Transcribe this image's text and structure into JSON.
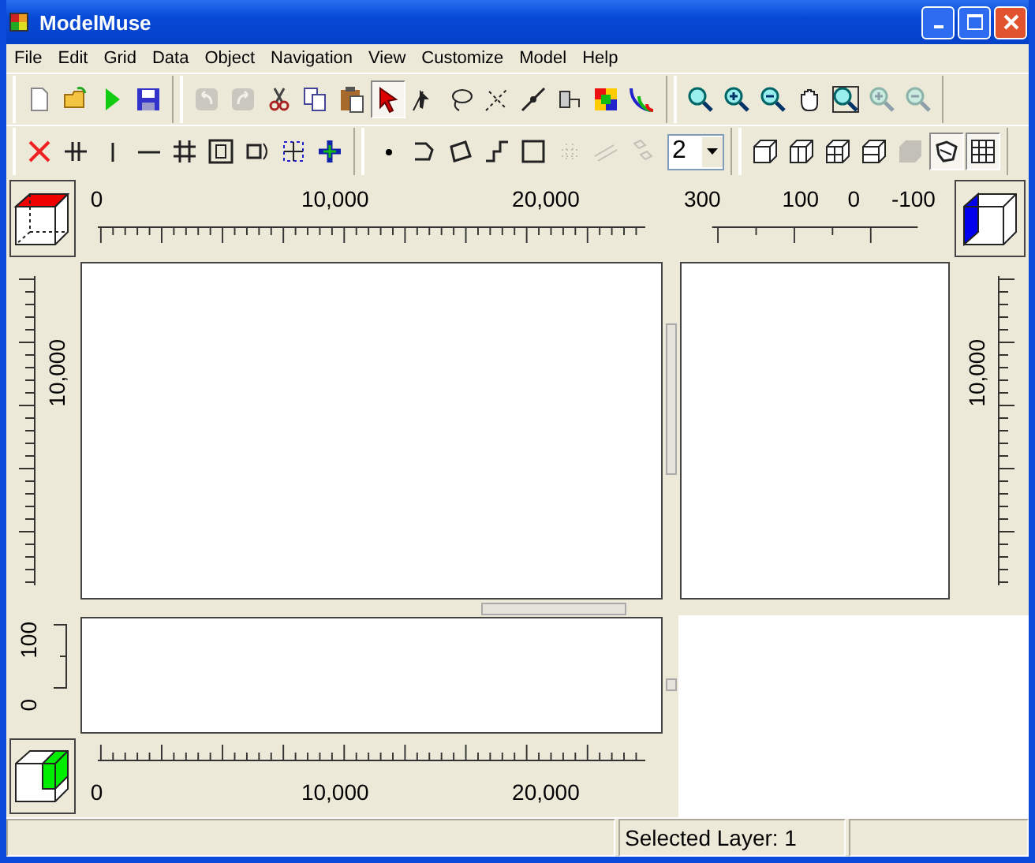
{
  "window": {
    "title": "ModelMuse"
  },
  "menu": [
    "File",
    "Edit",
    "Grid",
    "Data",
    "Object",
    "Navigation",
    "View",
    "Customize",
    "Model",
    "Help"
  ],
  "toolbars": [
    {
      "groups": [
        {
          "items": [
            {
              "kind": "new",
              "disabled": false,
              "selected": false
            },
            {
              "kind": "open",
              "disabled": false,
              "selected": false
            },
            {
              "kind": "run",
              "disabled": false,
              "selected": false
            },
            {
              "kind": "save",
              "disabled": false,
              "selected": false
            }
          ]
        },
        {
          "items": [
            {
              "kind": "undo",
              "disabled": true,
              "selected": false
            },
            {
              "kind": "redo",
              "disabled": true,
              "selected": false
            },
            {
              "kind": "cut",
              "disabled": false,
              "selected": false
            },
            {
              "kind": "copy",
              "disabled": false,
              "selected": false
            },
            {
              "kind": "paste",
              "disabled": false,
              "selected": false
            },
            {
              "kind": "pointer",
              "disabled": false,
              "selected": true
            },
            {
              "kind": "vertex",
              "disabled": false,
              "selected": false
            },
            {
              "kind": "lasso",
              "disabled": false,
              "selected": false
            },
            {
              "kind": "dashx",
              "disabled": false,
              "selected": false
            },
            {
              "kind": "nodeline",
              "disabled": false,
              "selected": false
            },
            {
              "kind": "connector",
              "disabled": false,
              "selected": false
            },
            {
              "kind": "colorgrid",
              "disabled": false,
              "selected": false
            },
            {
              "kind": "contour",
              "disabled": false,
              "selected": false
            }
          ]
        },
        {
          "items": [
            {
              "kind": "zoom",
              "disabled": false,
              "selected": false
            },
            {
              "kind": "zoomin",
              "disabled": false,
              "selected": false
            },
            {
              "kind": "zoomout",
              "disabled": false,
              "selected": false
            },
            {
              "kind": "pan",
              "disabled": false,
              "selected": false
            },
            {
              "kind": "zoomextent",
              "disabled": false,
              "selected": false
            },
            {
              "kind": "zoomin",
              "disabled": true,
              "selected": false
            },
            {
              "kind": "zoomout",
              "disabled": true,
              "selected": false
            }
          ]
        }
      ]
    },
    {
      "groups": [
        {
          "items": [
            {
              "kind": "redx",
              "disabled": false,
              "selected": false
            },
            {
              "kind": "splitcol",
              "disabled": false,
              "selected": false
            },
            {
              "kind": "vline",
              "disabled": false,
              "selected": false
            },
            {
              "kind": "hline",
              "disabled": false,
              "selected": false
            },
            {
              "kind": "hash",
              "disabled": false,
              "selected": false
            },
            {
              "kind": "boxgrid",
              "disabled": false,
              "selected": false
            },
            {
              "kind": "rotate",
              "disabled": false,
              "selected": false
            },
            {
              "kind": "dotbox",
              "disabled": false,
              "selected": false
            },
            {
              "kind": "plus",
              "disabled": false,
              "selected": false
            }
          ]
        },
        {
          "items": [
            {
              "kind": "point",
              "disabled": false,
              "selected": false
            },
            {
              "kind": "polyline",
              "disabled": false,
              "selected": false
            },
            {
              "kind": "polygon",
              "disabled": false,
              "selected": false
            },
            {
              "kind": "step",
              "disabled": false,
              "selected": false
            },
            {
              "kind": "rect",
              "disabled": false,
              "selected": false
            },
            {
              "kind": "dots",
              "disabled": true,
              "selected": false
            },
            {
              "kind": "lines",
              "disabled": true,
              "selected": false
            },
            {
              "kind": "diamonds",
              "disabled": true,
              "selected": false
            },
            {
              "kind": "spin",
              "value": "2"
            }
          ]
        },
        {
          "items": [
            {
              "kind": "cube",
              "disabled": false,
              "selected": false
            },
            {
              "kind": "cubecut",
              "disabled": false,
              "selected": false
            },
            {
              "kind": "cubegrid",
              "disabled": false,
              "selected": false
            },
            {
              "kind": "cubeside",
              "disabled": false,
              "selected": false
            },
            {
              "kind": "solidcube",
              "disabled": true,
              "selected": false
            },
            {
              "kind": "blob",
              "disabled": false,
              "selected": true
            },
            {
              "kind": "table",
              "disabled": false,
              "selected": true
            }
          ]
        }
      ]
    }
  ],
  "top_ruler": {
    "labels": [
      "0",
      "10,000",
      "20,000"
    ]
  },
  "side_top_ruler": {
    "labels": [
      "300",
      "100",
      "0",
      "-100"
    ]
  },
  "left_ruler": {
    "labels": [
      "10,000"
    ]
  },
  "right_ruler": {
    "labels": [
      "10,000"
    ]
  },
  "front_left_ruler": {
    "labels": [
      "100",
      "0"
    ]
  },
  "bottom_ruler": {
    "labels": [
      "0",
      "10,000",
      "20,000"
    ]
  },
  "status_bar": {
    "layer": "Selected Layer: 1"
  }
}
